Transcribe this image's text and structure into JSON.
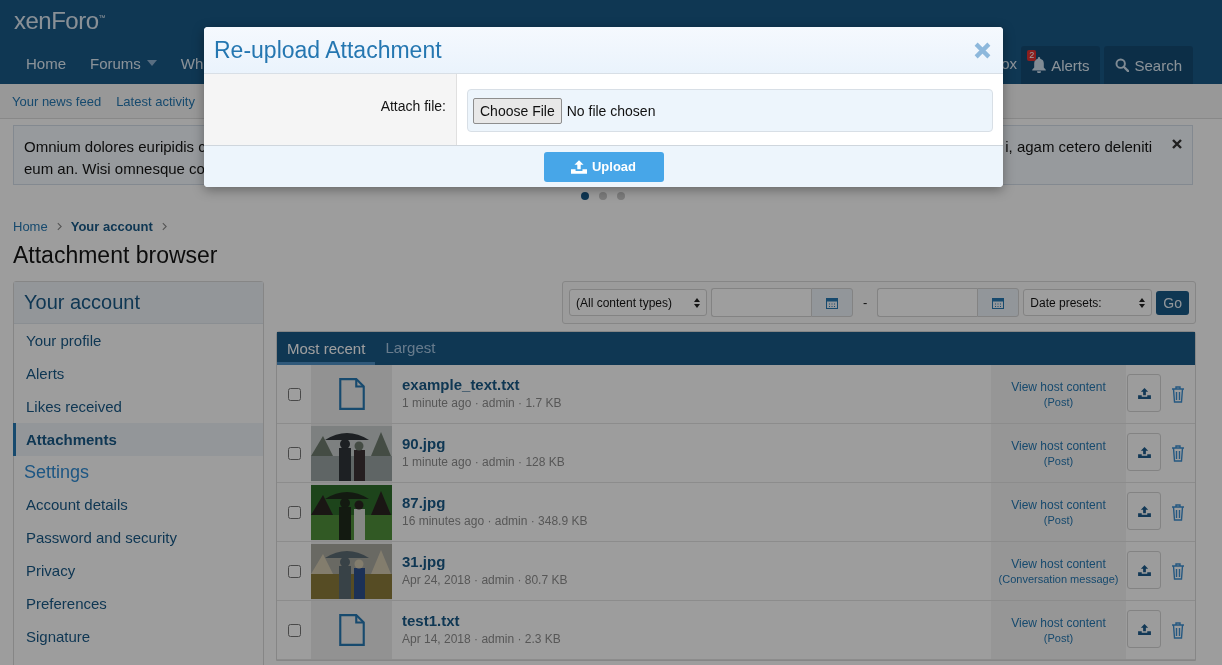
{
  "header": {
    "logo": "xenForo$^{™}$"
  },
  "nav": [
    {
      "label": "Home",
      "has_menu": false
    },
    {
      "label": "Forums",
      "has_menu": true
    },
    {
      "label": "Wh",
      "has_menu": false
    }
  ],
  "nav_right": [
    {
      "kind": "text",
      "label": "ox"
    },
    {
      "kind": "alerts",
      "label": "Alerts",
      "badge": "2"
    },
    {
      "kind": "search",
      "label": "Search"
    }
  ],
  "subnav": [
    "Your news feed",
    "Latest activity"
  ],
  "notice": {
    "lines_left": [
      "Omnium dolores euripidis c",
      "eum an. Wisi omnesque co"
    ],
    "line_right": "i, agam cetero deleniti",
    "dismissible": true
  },
  "carousel_dots": [
    {
      "selected": true
    },
    {
      "selected": false
    },
    {
      "selected": false
    }
  ],
  "breadcrumbs": [
    {
      "label": "Home",
      "current": false
    },
    {
      "label": "Your account",
      "current": true
    }
  ],
  "title": "Attachment browser",
  "sidebar": [
    {
      "kind": "header",
      "label": "Your account"
    },
    {
      "kind": "link",
      "label": "Your profile",
      "selected": false
    },
    {
      "kind": "link",
      "label": "Alerts",
      "selected": false
    },
    {
      "kind": "link",
      "label": "Likes received",
      "selected": false
    },
    {
      "kind": "link",
      "label": "Attachments",
      "selected": true
    },
    {
      "kind": "heading",
      "label": "Settings"
    },
    {
      "kind": "link",
      "label": "Account details",
      "selected": false
    },
    {
      "kind": "link",
      "label": "Password and security",
      "selected": false
    },
    {
      "kind": "link",
      "label": "Privacy",
      "selected": false
    },
    {
      "kind": "link",
      "label": "Preferences",
      "selected": false
    },
    {
      "kind": "link",
      "label": "Signature",
      "selected": false
    }
  ],
  "filters": {
    "content_type": "(All content types)",
    "separator": "-",
    "date_presets": "Date presets:",
    "go": "Go"
  },
  "tabs": [
    {
      "label": "Most recent",
      "selected": true
    },
    {
      "label": "Largest",
      "selected": false
    }
  ],
  "rows": [
    {
      "kind": "file",
      "name": "example_text.txt",
      "meta": "1 minute ago · admin · 1.7 KB",
      "host_link": "View host content",
      "host_type": "(Post)",
      "checked": false
    },
    {
      "kind": "picture",
      "name": "90.jpg",
      "meta": "1 minute ago · admin · 128 KB",
      "host_link": "View host content",
      "host_type": "(Post)",
      "checked": false
    },
    {
      "kind": "picture",
      "name": "87.jpg",
      "meta": "16 minutes ago · admin · 348.9 KB",
      "host_link": "View host content",
      "host_type": "(Post)",
      "checked": false
    },
    {
      "kind": "picture",
      "name": "31.jpg",
      "meta": "Apr 24, 2018 · admin · 80.7 KB",
      "host_link": "View host content",
      "host_type": "(Conversation message)",
      "checked": false
    },
    {
      "kind": "file",
      "name": "test1.txt",
      "meta": "Apr 14, 2018 · admin · 2.3 KB",
      "host_link": "View host content",
      "host_type": "(Post)",
      "checked": false
    }
  ],
  "modal": {
    "title": "Re-upload Attachment",
    "field_label": "Attach file:",
    "choose_button": "Choose File",
    "file_status": "No file chosen",
    "submit": "Upload"
  }
}
